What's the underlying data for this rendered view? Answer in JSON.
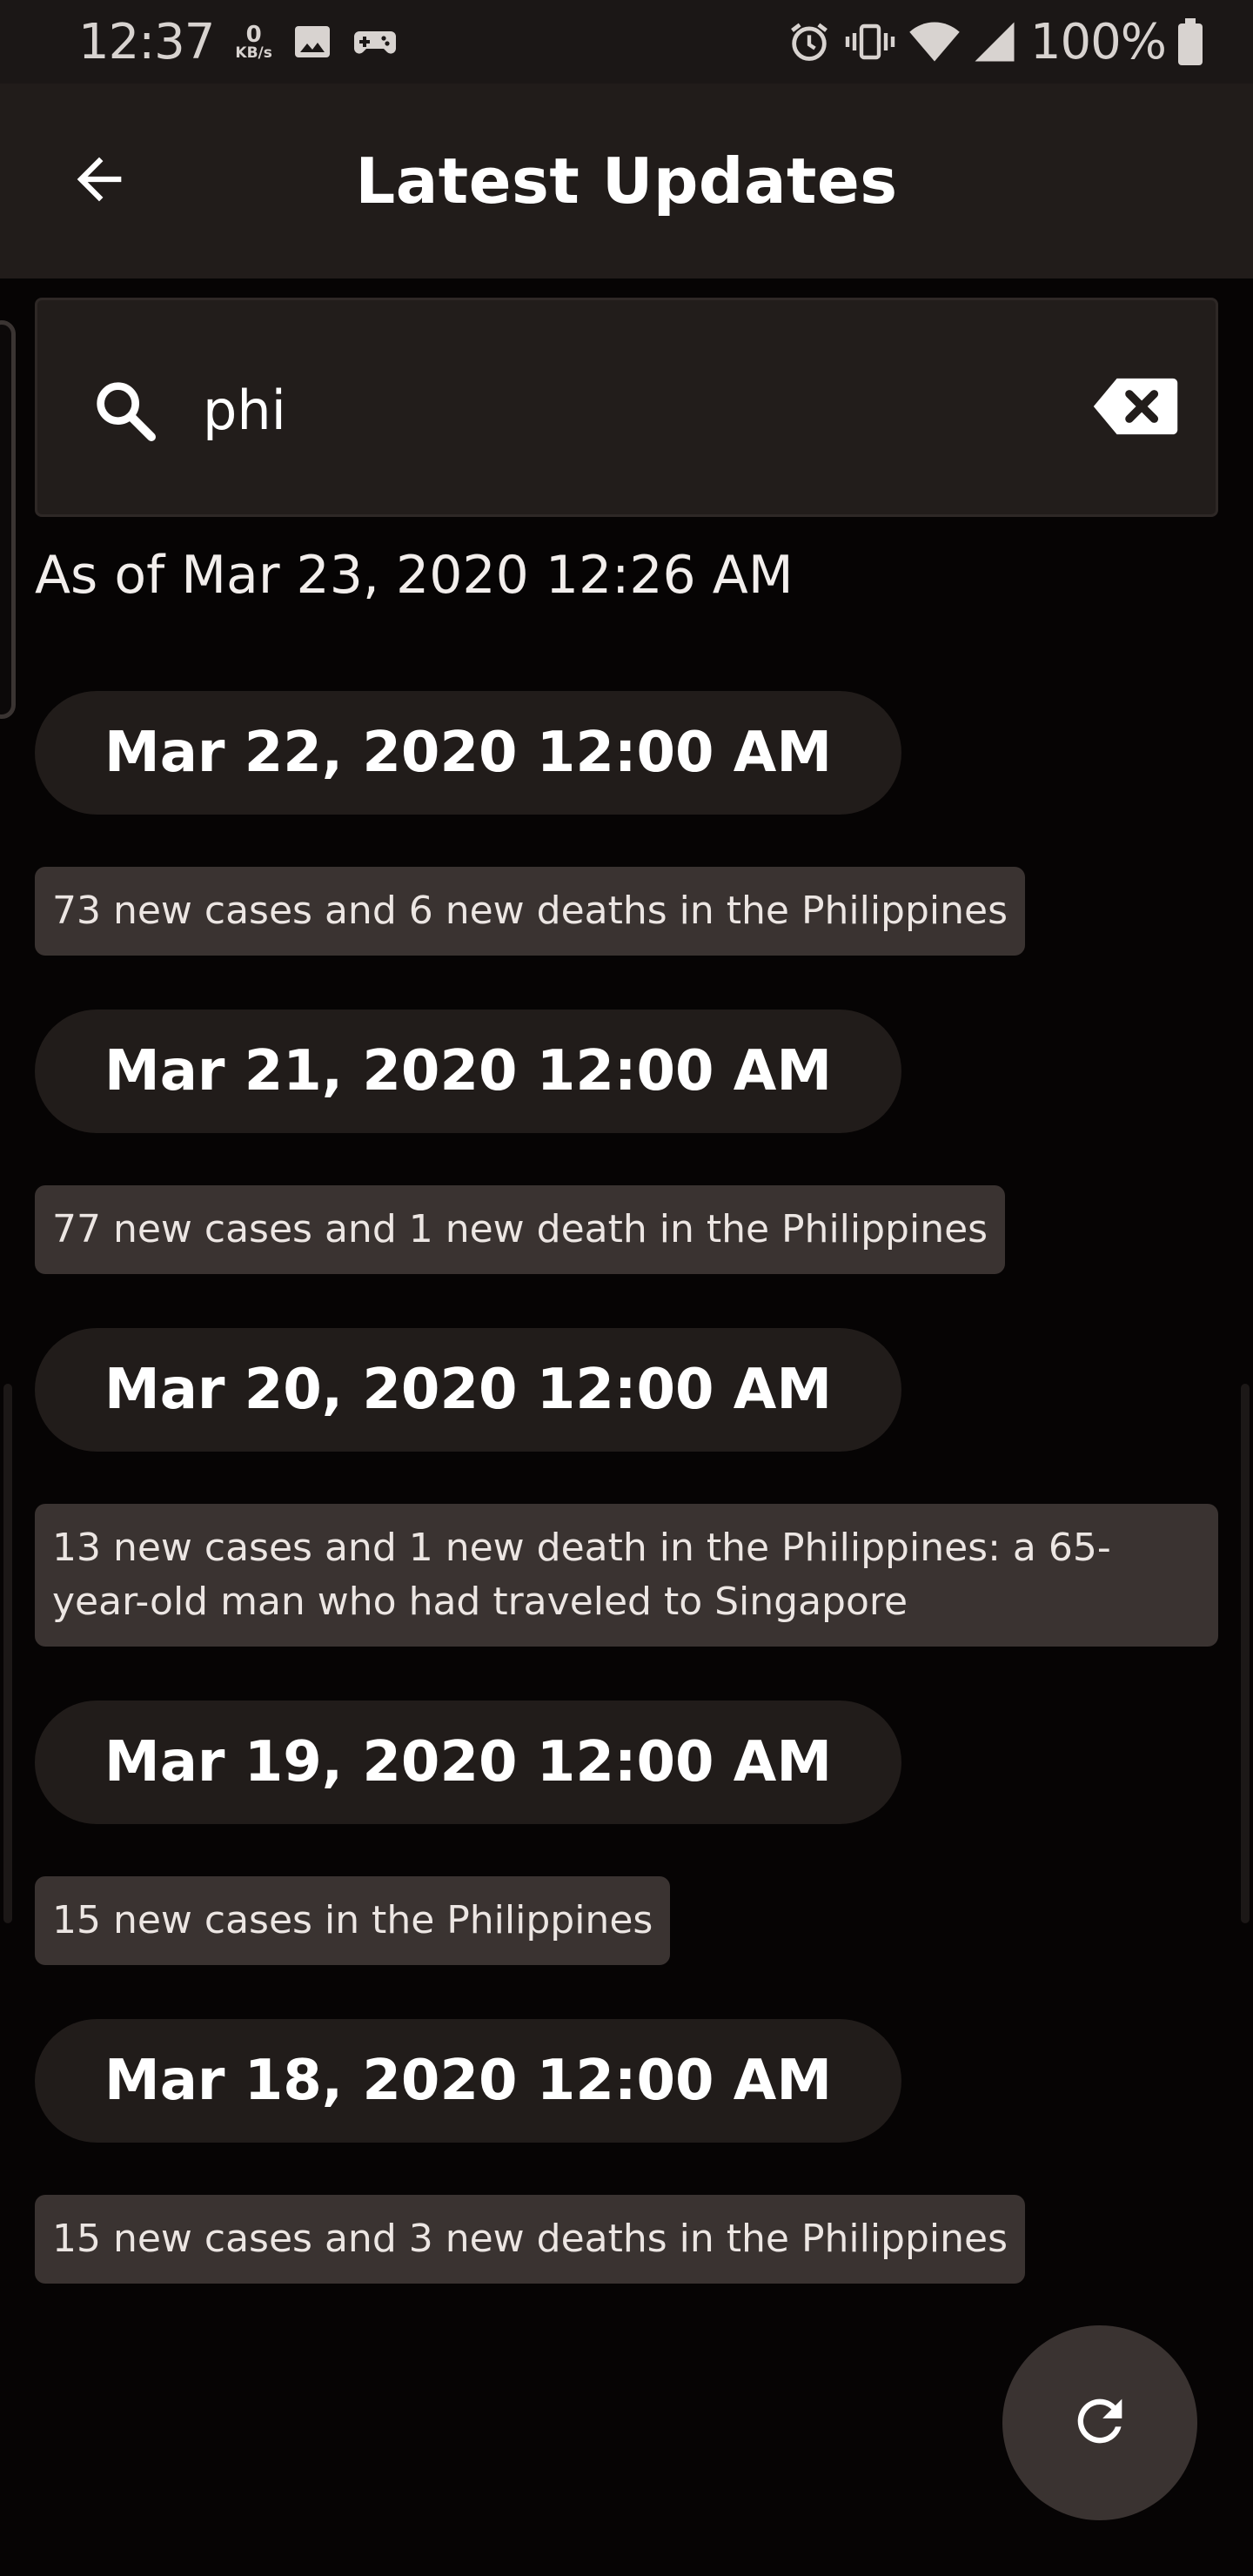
{
  "status_bar": {
    "time": "12:37",
    "net_speed_value": "0",
    "net_speed_unit": "KB/s",
    "left_icons": [
      "image-icon",
      "game-controller-icon"
    ],
    "right_icons": [
      "alarm-icon",
      "vibrate-icon",
      "wifi-icon",
      "cell-signal-icon",
      "battery-icon"
    ],
    "battery": "100%"
  },
  "app_bar": {
    "title": "Latest Updates",
    "back_icon": "arrow-left-icon"
  },
  "search": {
    "value": "phi",
    "icon": "search-icon",
    "clear_icon": "backspace-clear-icon"
  },
  "as_of": "As of Mar 23, 2020 12:26 AM",
  "updates": [
    {
      "date": "Mar 22, 2020 12:00 AM",
      "text": "73 new cases and 6 new deaths in the Philippines"
    },
    {
      "date": "Mar 21, 2020 12:00 AM",
      "text": "77 new cases and 1 new death in the Philippines"
    },
    {
      "date": "Mar 20, 2020 12:00 AM",
      "text": "13 new cases and 1 new death in the Philippines: a 65-year-old man who had traveled to Singapore"
    },
    {
      "date": "Mar 19, 2020 12:00 AM",
      "text": "15 new cases in the Philippines"
    },
    {
      "date": "Mar 18, 2020 12:00 AM",
      "text": "15 new cases and 3 new deaths in the Philippines"
    }
  ],
  "fab": {
    "icon": "refresh-icon"
  },
  "colors": {
    "background": "#060404",
    "app_bar": "#211c1a",
    "chip_dark": "#211c1a",
    "chip_light": "#3a3331",
    "text": "#ffffff"
  }
}
